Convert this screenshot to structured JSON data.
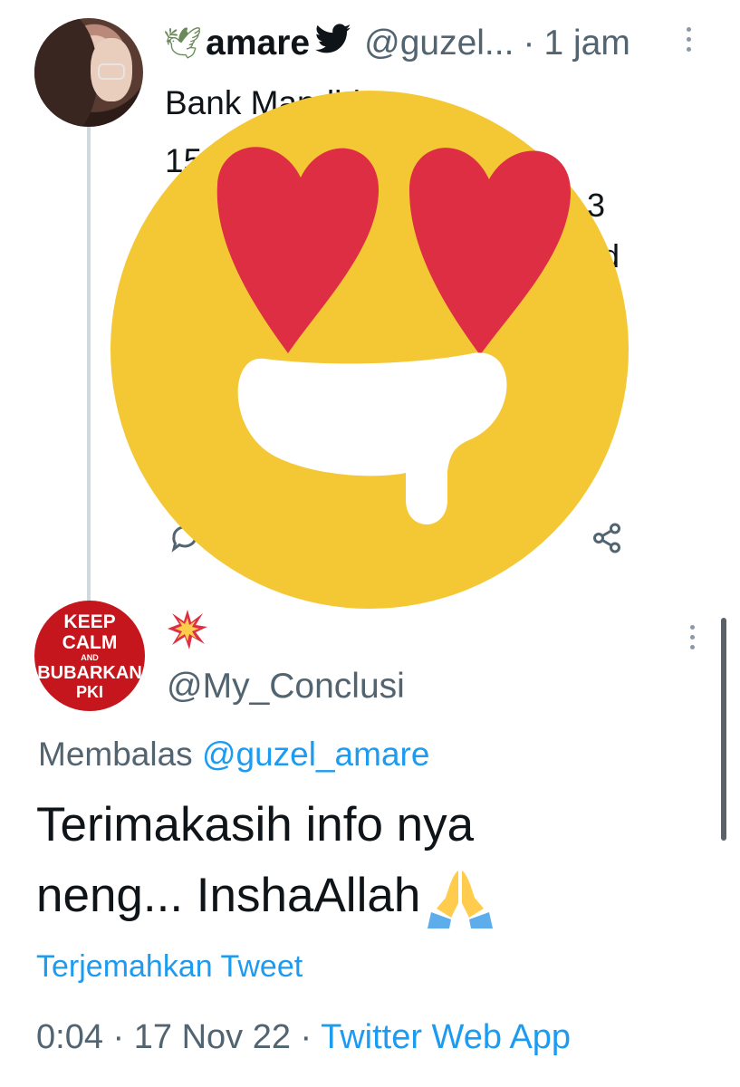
{
  "tweet1": {
    "display_name": "amare",
    "handle": "@guzel...",
    "separator": "·",
    "time": "1 jam",
    "body_lines": [
      "Bank Mandiri :",
      "15"
    ],
    "visible_fragments": [
      "3",
      "d"
    ]
  },
  "tweet2": {
    "handle": "@My_Conclusi",
    "avatar_text": [
      "KEEP",
      "CALM",
      "AND",
      "BUBARKAN",
      "PKI"
    ],
    "replying_prefix": "Membalas",
    "replying_to": "@guzel_amare",
    "text_lines": [
      "Terimakasih info nya",
      "neng... InshaAllah"
    ],
    "translate_label": "Terjemahkan Tweet",
    "time": "0:04",
    "dot1": "·",
    "date": "17 Nov 22",
    "dot2": "·",
    "source": "Twitter Web App"
  },
  "colors": {
    "link": "#1d9bf0",
    "muted": "#536471",
    "emoji_yellow": "#f4c735",
    "heart_red": "#dd2e44"
  },
  "icons": [
    "dove-icon",
    "twitter-bird-icon",
    "more-options-icon",
    "reply-icon",
    "share-icon",
    "heart-eyes-emoji-sticker",
    "collision-icon",
    "folded-hands-icon"
  ]
}
